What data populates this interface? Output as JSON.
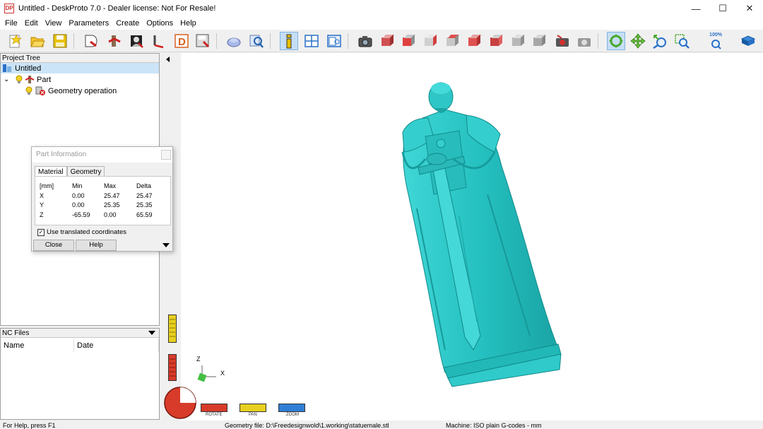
{
  "window": {
    "icon_text": "DP",
    "title": "Untitled - DeskProto 7.0 - Dealer license: Not For Resale!",
    "minimize": "—",
    "maximize": "☐",
    "close": "✕"
  },
  "menu": [
    "File",
    "Edit",
    "View",
    "Parameters",
    "Create",
    "Options",
    "Help"
  ],
  "toolbar": {
    "zoom_percent": "100%"
  },
  "project_tree": {
    "header": "Project Tree",
    "root": "Untitled",
    "part": "Part",
    "operation": "Geometry operation",
    "expand": "⌄"
  },
  "nc_files": {
    "header": "NC Files",
    "columns": [
      "Name",
      "Date"
    ]
  },
  "dialog": {
    "title": "Part Information",
    "tabs": [
      "Material",
      "Geometry"
    ],
    "headers": [
      "[mm]",
      "Min",
      "Max",
      "Delta"
    ],
    "rows": [
      [
        "X",
        "0.00",
        "25.47",
        "25.47"
      ],
      [
        "Y",
        "0.00",
        "25.35",
        "25.35"
      ],
      [
        "Z",
        "-65.59",
        "0.00",
        "65.59"
      ]
    ],
    "checkbox_label": "Use translated coordinates",
    "checkbox_checked": true,
    "close_label": "Close",
    "help_label": "Help"
  },
  "viewport": {
    "axis_z": "Z",
    "axis_x": "X",
    "controls": [
      "ROTATE",
      "PAN",
      "ZOOM"
    ]
  },
  "status": {
    "help": "For Help, press F1",
    "geometry_file": "Geometry file: D:\\Freedesignwold\\1.working\\statuemale.stl",
    "machine": "Machine: ISO plain G-codes - mm"
  },
  "colors": {
    "model": "#2ec4c4",
    "model_dark": "#158f8f",
    "rotate": "#d83b2a",
    "pan": "#e8d020",
    "zoom": "#2f7fd6"
  }
}
